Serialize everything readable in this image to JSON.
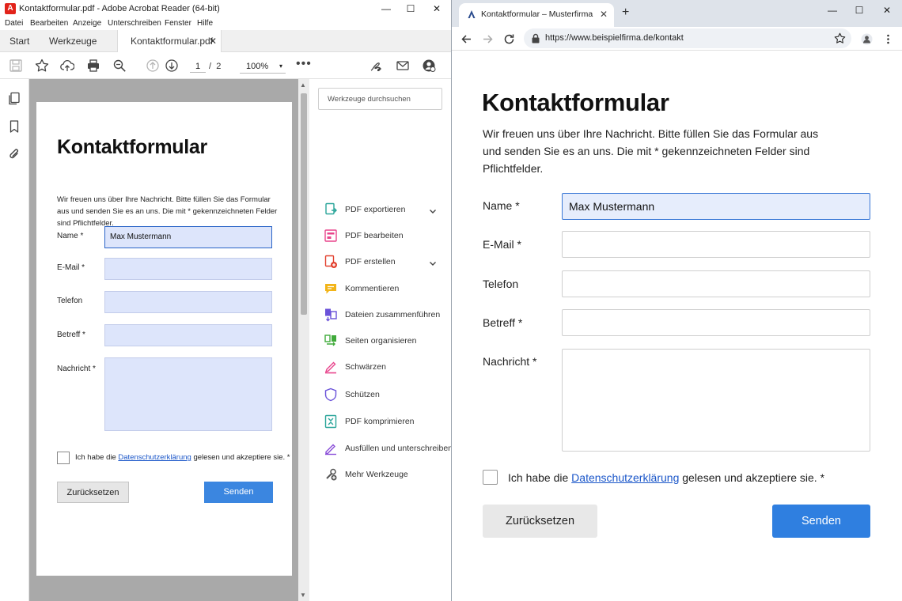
{
  "acrobat": {
    "logo_glyph": "A",
    "window_title": "Kontaktformular.pdf - Adobe Acrobat Reader (64-bit)",
    "window_controls": {
      "minimize": "—",
      "maximize": "☐",
      "close": "✕"
    },
    "menu": [
      "Datei",
      "Bearbeiten",
      "Anzeige",
      "Unterschreiben",
      "Fenster",
      "Hilfe"
    ],
    "tabs": {
      "start": "Start",
      "tools": "Werkzeuge",
      "document": "Kontaktformular.pdf",
      "close": "✕"
    },
    "toolbar": {
      "page_current": "1",
      "page_separator": "/",
      "page_total": "2",
      "zoom": "100%",
      "zoom_caret": "▾",
      "more": "•••"
    },
    "scroll_arrows": {
      "up": "▲",
      "down": "▼"
    },
    "page": {
      "title": "Kontaktformular",
      "intro": "Wir freuen uns über Ihre Nachricht. Bitte füllen Sie das Formular aus und senden Sie es an uns. Die mit * gekennzeichneten Felder sind Pflichtfelder.",
      "labels": {
        "name": "Name *",
        "email": "E-Mail *",
        "phone": "Telefon",
        "subject": "Betreff *",
        "message": "Nachricht *"
      },
      "values": {
        "name": "Max Mustermann"
      },
      "consent_prefix": "Ich habe die ",
      "consent_link": "Datenschutzerklärung",
      "consent_suffix": " gelesen und akzeptiere sie. *",
      "reset_button": "Zurücksetzen",
      "send_button": "Senden"
    },
    "tools_panel": {
      "search_placeholder": "Werkzeuge durchsuchen",
      "items": [
        {
          "label": "PDF exportieren",
          "icon": "export-pdf-icon",
          "color": "#2aa59a",
          "expandable": true
        },
        {
          "label": "PDF bearbeiten",
          "icon": "edit-pdf-icon",
          "color": "#e8448c",
          "expandable": false
        },
        {
          "label": "PDF erstellen",
          "icon": "create-pdf-icon",
          "color": "#e2412f",
          "expandable": true
        },
        {
          "label": "Kommentieren",
          "icon": "comment-icon",
          "color": "#f2b418",
          "expandable": false
        },
        {
          "label": "Dateien zusammenführen",
          "icon": "combine-files-icon",
          "color": "#6a52d9",
          "expandable": false
        },
        {
          "label": "Seiten organisieren",
          "icon": "organize-pages-icon",
          "color": "#3faa3a",
          "expandable": false
        },
        {
          "label": "Schwärzen",
          "icon": "redact-icon",
          "color": "#e8448c",
          "expandable": false
        },
        {
          "label": "Schützen",
          "icon": "protect-icon",
          "color": "#6a52d9",
          "expandable": false
        },
        {
          "label": "PDF komprimieren",
          "icon": "compress-pdf-icon",
          "color": "#2aa59a",
          "expandable": false
        },
        {
          "label": "Ausfüllen und unterschreiben",
          "icon": "fill-sign-icon",
          "color": "#8a4fd8",
          "expandable": false
        },
        {
          "label": "Mehr Werkzeuge",
          "icon": "more-tools-icon",
          "color": "#555555",
          "expandable": false
        }
      ]
    }
  },
  "browser": {
    "tab_title": "Kontaktformular – Musterfirma",
    "tab_close": "✕",
    "new_tab": "+",
    "window_controls": {
      "minimize": "—",
      "maximize": "☐",
      "close": "✕"
    },
    "url": "https://www.beispielfirma.de/kontakt",
    "page": {
      "title": "Kontaktformular",
      "intro": "Wir freuen uns über Ihre Nachricht. Bitte füllen Sie das Formular aus und senden Sie es an uns. Die mit * gekennzeichneten Felder sind Pflichtfelder.",
      "labels": {
        "name": "Name *",
        "email": "E-Mail *",
        "phone": "Telefon",
        "subject": "Betreff *",
        "message": "Nachricht *"
      },
      "values": {
        "name": "Max Mustermann"
      },
      "consent_prefix": "Ich habe die ",
      "consent_link": "Datenschutzerklärung",
      "consent_suffix": " gelesen und akzeptiere sie. *",
      "reset_button": "Zurücksetzen",
      "send_button": "Senden"
    }
  },
  "colors": {
    "accent_blue": "#2f7fe0",
    "field_fill": "#dde5fb",
    "acrobat_red": "#e2231a",
    "link": "#1a56c9"
  }
}
